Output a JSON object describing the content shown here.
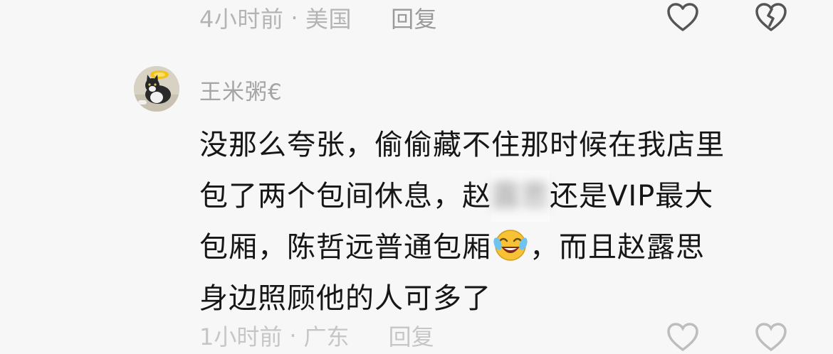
{
  "top_meta": {
    "time": "4小时前",
    "separator": "·",
    "location": "美国",
    "reply_label": "回复"
  },
  "comment": {
    "username": "王米粥€",
    "lines": [
      "没那么夸张，偷偷藏不住那时候在我店里",
      "包了两个包间休息，赵",
      "还是VIP最大",
      "包厢，陈哲远普通包厢",
      "，而且赵露思",
      "身边照顾他的人可多了"
    ],
    "blurred_text": "露思",
    "emoji_icon": "laughing-crying-emoji"
  },
  "next_comment": {
    "time": "1小时前",
    "location": "广东",
    "reply_label": "回复"
  },
  "icons": {
    "like": "heart-outline-icon",
    "dislike": "broken-heart-icon"
  },
  "colors": {
    "background": "#f7f7f7",
    "meta_text": "#b4b4b4",
    "body_text": "#161616",
    "username": "#a5a5a5"
  }
}
